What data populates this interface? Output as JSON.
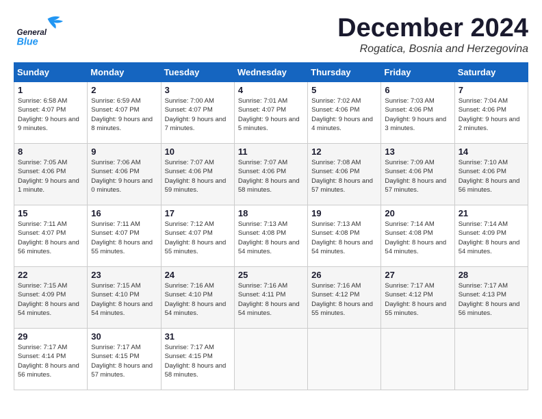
{
  "logo": {
    "general": "General",
    "blue": "Blue"
  },
  "title": "December 2024",
  "subtitle": "Rogatica, Bosnia and Herzegovina",
  "weekdays": [
    "Sunday",
    "Monday",
    "Tuesday",
    "Wednesday",
    "Thursday",
    "Friday",
    "Saturday"
  ],
  "weeks": [
    [
      {
        "day": "1",
        "sunrise": "Sunrise: 6:58 AM",
        "sunset": "Sunset: 4:07 PM",
        "daylight": "Daylight: 9 hours and 9 minutes."
      },
      {
        "day": "2",
        "sunrise": "Sunrise: 6:59 AM",
        "sunset": "Sunset: 4:07 PM",
        "daylight": "Daylight: 9 hours and 8 minutes."
      },
      {
        "day": "3",
        "sunrise": "Sunrise: 7:00 AM",
        "sunset": "Sunset: 4:07 PM",
        "daylight": "Daylight: 9 hours and 7 minutes."
      },
      {
        "day": "4",
        "sunrise": "Sunrise: 7:01 AM",
        "sunset": "Sunset: 4:07 PM",
        "daylight": "Daylight: 9 hours and 5 minutes."
      },
      {
        "day": "5",
        "sunrise": "Sunrise: 7:02 AM",
        "sunset": "Sunset: 4:06 PM",
        "daylight": "Daylight: 9 hours and 4 minutes."
      },
      {
        "day": "6",
        "sunrise": "Sunrise: 7:03 AM",
        "sunset": "Sunset: 4:06 PM",
        "daylight": "Daylight: 9 hours and 3 minutes."
      },
      {
        "day": "7",
        "sunrise": "Sunrise: 7:04 AM",
        "sunset": "Sunset: 4:06 PM",
        "daylight": "Daylight: 9 hours and 2 minutes."
      }
    ],
    [
      {
        "day": "8",
        "sunrise": "Sunrise: 7:05 AM",
        "sunset": "Sunset: 4:06 PM",
        "daylight": "Daylight: 9 hours and 1 minute."
      },
      {
        "day": "9",
        "sunrise": "Sunrise: 7:06 AM",
        "sunset": "Sunset: 4:06 PM",
        "daylight": "Daylight: 9 hours and 0 minutes."
      },
      {
        "day": "10",
        "sunrise": "Sunrise: 7:07 AM",
        "sunset": "Sunset: 4:06 PM",
        "daylight": "Daylight: 8 hours and 59 minutes."
      },
      {
        "day": "11",
        "sunrise": "Sunrise: 7:07 AM",
        "sunset": "Sunset: 4:06 PM",
        "daylight": "Daylight: 8 hours and 58 minutes."
      },
      {
        "day": "12",
        "sunrise": "Sunrise: 7:08 AM",
        "sunset": "Sunset: 4:06 PM",
        "daylight": "Daylight: 8 hours and 57 minutes."
      },
      {
        "day": "13",
        "sunrise": "Sunrise: 7:09 AM",
        "sunset": "Sunset: 4:06 PM",
        "daylight": "Daylight: 8 hours and 57 minutes."
      },
      {
        "day": "14",
        "sunrise": "Sunrise: 7:10 AM",
        "sunset": "Sunset: 4:06 PM",
        "daylight": "Daylight: 8 hours and 56 minutes."
      }
    ],
    [
      {
        "day": "15",
        "sunrise": "Sunrise: 7:11 AM",
        "sunset": "Sunset: 4:07 PM",
        "daylight": "Daylight: 8 hours and 56 minutes."
      },
      {
        "day": "16",
        "sunrise": "Sunrise: 7:11 AM",
        "sunset": "Sunset: 4:07 PM",
        "daylight": "Daylight: 8 hours and 55 minutes."
      },
      {
        "day": "17",
        "sunrise": "Sunrise: 7:12 AM",
        "sunset": "Sunset: 4:07 PM",
        "daylight": "Daylight: 8 hours and 55 minutes."
      },
      {
        "day": "18",
        "sunrise": "Sunrise: 7:13 AM",
        "sunset": "Sunset: 4:08 PM",
        "daylight": "Daylight: 8 hours and 54 minutes."
      },
      {
        "day": "19",
        "sunrise": "Sunrise: 7:13 AM",
        "sunset": "Sunset: 4:08 PM",
        "daylight": "Daylight: 8 hours and 54 minutes."
      },
      {
        "day": "20",
        "sunrise": "Sunrise: 7:14 AM",
        "sunset": "Sunset: 4:08 PM",
        "daylight": "Daylight: 8 hours and 54 minutes."
      },
      {
        "day": "21",
        "sunrise": "Sunrise: 7:14 AM",
        "sunset": "Sunset: 4:09 PM",
        "daylight": "Daylight: 8 hours and 54 minutes."
      }
    ],
    [
      {
        "day": "22",
        "sunrise": "Sunrise: 7:15 AM",
        "sunset": "Sunset: 4:09 PM",
        "daylight": "Daylight: 8 hours and 54 minutes."
      },
      {
        "day": "23",
        "sunrise": "Sunrise: 7:15 AM",
        "sunset": "Sunset: 4:10 PM",
        "daylight": "Daylight: 8 hours and 54 minutes."
      },
      {
        "day": "24",
        "sunrise": "Sunrise: 7:16 AM",
        "sunset": "Sunset: 4:10 PM",
        "daylight": "Daylight: 8 hours and 54 minutes."
      },
      {
        "day": "25",
        "sunrise": "Sunrise: 7:16 AM",
        "sunset": "Sunset: 4:11 PM",
        "daylight": "Daylight: 8 hours and 54 minutes."
      },
      {
        "day": "26",
        "sunrise": "Sunrise: 7:16 AM",
        "sunset": "Sunset: 4:12 PM",
        "daylight": "Daylight: 8 hours and 55 minutes."
      },
      {
        "day": "27",
        "sunrise": "Sunrise: 7:17 AM",
        "sunset": "Sunset: 4:12 PM",
        "daylight": "Daylight: 8 hours and 55 minutes."
      },
      {
        "day": "28",
        "sunrise": "Sunrise: 7:17 AM",
        "sunset": "Sunset: 4:13 PM",
        "daylight": "Daylight: 8 hours and 56 minutes."
      }
    ],
    [
      {
        "day": "29",
        "sunrise": "Sunrise: 7:17 AM",
        "sunset": "Sunset: 4:14 PM",
        "daylight": "Daylight: 8 hours and 56 minutes."
      },
      {
        "day": "30",
        "sunrise": "Sunrise: 7:17 AM",
        "sunset": "Sunset: 4:15 PM",
        "daylight": "Daylight: 8 hours and 57 minutes."
      },
      {
        "day": "31",
        "sunrise": "Sunrise: 7:17 AM",
        "sunset": "Sunset: 4:15 PM",
        "daylight": "Daylight: 8 hours and 58 minutes."
      },
      null,
      null,
      null,
      null
    ]
  ]
}
